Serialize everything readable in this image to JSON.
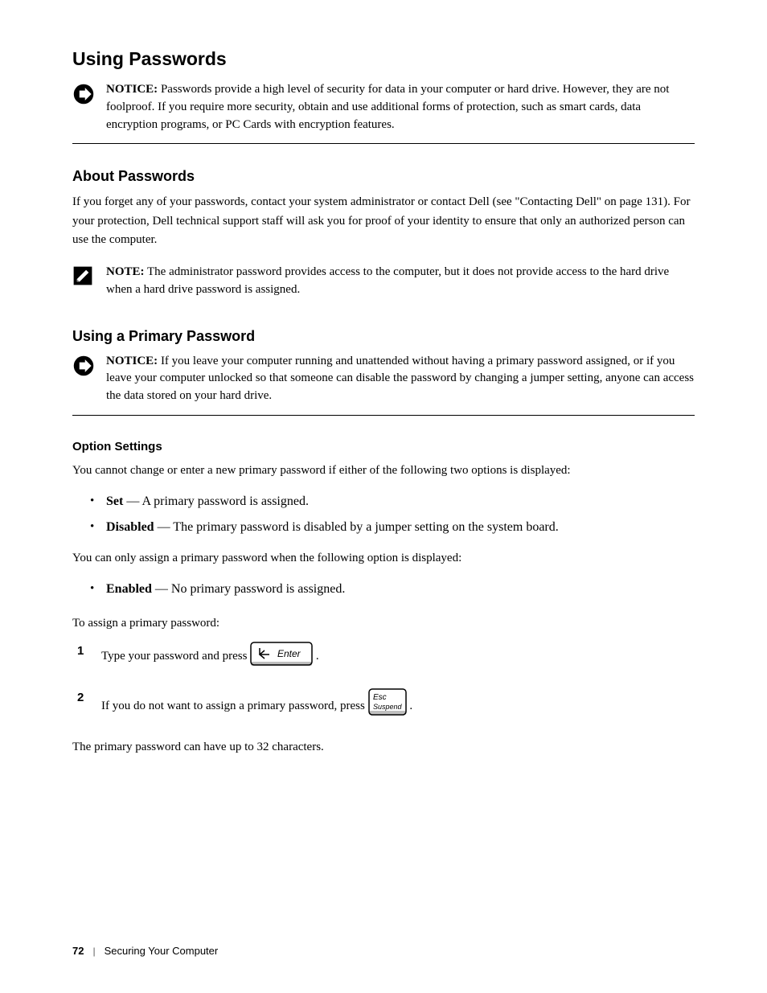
{
  "headings": {
    "h1": "Using Passwords",
    "h2": "About Passwords",
    "h3": "Using a Primary Password"
  },
  "notice": {
    "label": "NOTICE:",
    "text": "Passwords provide a high level of security for data in your computer or hard drive. However, they are not foolproof. If you require more security, obtain and use additional forms of protection, such as smart cards, data encryption programs, or PC Cards with encryption features."
  },
  "body": {
    "p1a": "If you forget any of your passwords, contact your system administrator or contact Dell (see \"Contacting Dell\" on page 131). For your protection, Dell technical support staff will ask you for proof of your identity to ensure that only an authorized person can use the computer.",
    "note_label": "NOTE:",
    "note_text": "The administrator password provides access to the computer, but it does not provide access to the hard drive when a hard drive password is assigned."
  },
  "notice2": {
    "label": "NOTICE:",
    "text": "If you leave your computer running and unattended without having a primary password assigned, or if you leave your computer unlocked so that someone can disable the password by changing a jumper setting, anyone can access the data stored on your hard drive."
  },
  "section2": {
    "subhead": "Option Settings",
    "intro": "You cannot change or enter a new primary password if either of the following two options is displayed:",
    "bullets": {
      "b1": "Set — A primary password is assigned.",
      "b1_strong": "Set",
      "b2": "Disabled — The primary password is disabled by a jumper setting on the system board.",
      "b2_strong": "Disabled"
    },
    "intro2": "You can only assign a primary password when the following option is displayed:",
    "bullets2": {
      "b1": "Enabled — No primary password is assigned.",
      "b1_strong": "Enabled"
    }
  },
  "steps_head": "To assign a primary password:",
  "steps": {
    "s1_pre": "Type your password and press ",
    "s1_post": ".",
    "s2_pre": "If you do not want to assign a primary password, press ",
    "s2_post": "."
  },
  "trailing": "The primary password can have up to 32 characters.",
  "footer": {
    "pn": "72",
    "sep": "|",
    "section": "Securing Your Computer"
  },
  "keys": {
    "enter": "Enter",
    "esc_line1": "Esc",
    "esc_line2": "Suspend"
  }
}
